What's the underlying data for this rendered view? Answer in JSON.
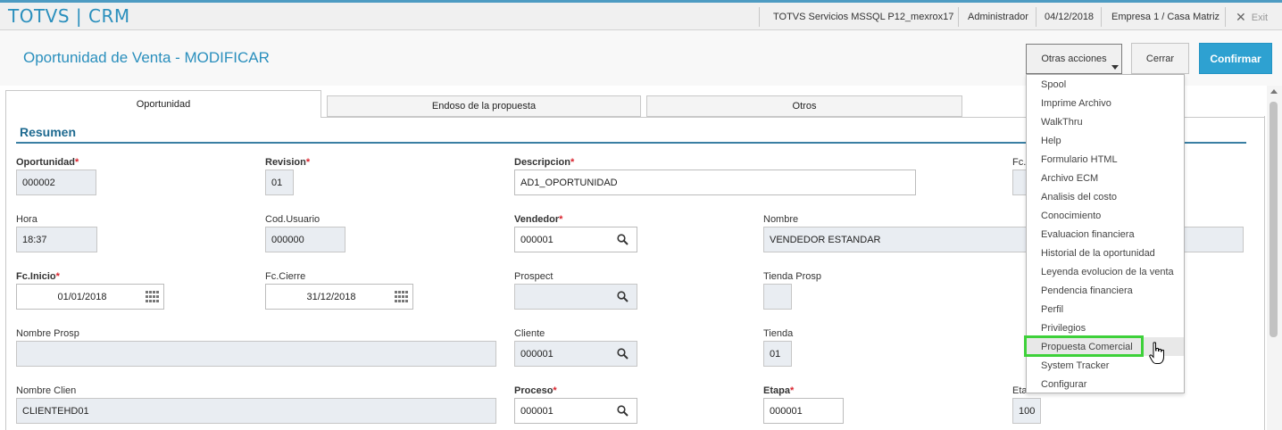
{
  "topbar": {
    "brand": "TOTVS | CRM",
    "server": "TOTVS Servicios MSSQL P12_mexrox17",
    "user": "Administrador",
    "date": "04/12/2018",
    "company": "Empresa 1 / Casa Matriz",
    "exit_label": "Exit"
  },
  "header": {
    "title": "Oportunidad de Venta - MODIFICAR",
    "otras_acciones": "Otras acciones",
    "cerrar": "Cerrar",
    "confirmar": "Confirmar"
  },
  "tabs": [
    {
      "label": "Oportunidad"
    },
    {
      "label": "Endoso de la propuesta"
    },
    {
      "label": "Otros"
    }
  ],
  "section": {
    "title": "Resumen"
  },
  "fields": {
    "oportunidad": {
      "label": "Oportunidad",
      "value": "000002"
    },
    "revision": {
      "label": "Revision",
      "value": "01"
    },
    "descripcion": {
      "label": "Descripcion",
      "value": "AD1_OPORTUNIDAD"
    },
    "fc_partial": {
      "label": "Fc."
    },
    "hora": {
      "label": "Hora",
      "value": "18:37"
    },
    "cod_usuario": {
      "label": "Cod.Usuario",
      "value": "000000"
    },
    "vendedor": {
      "label": "Vendedor",
      "value": "000001"
    },
    "nombre": {
      "label": "Nombre",
      "value": "VENDEDOR ESTANDAR"
    },
    "fc_inicio": {
      "label": "Fc.Inicio",
      "value": "01/01/2018"
    },
    "fc_cierre": {
      "label": "Fc.Cierre",
      "value": "31/12/2018"
    },
    "prospect": {
      "label": "Prospect",
      "value": ""
    },
    "tienda_prosp": {
      "label": "Tienda Prosp",
      "value": ""
    },
    "nombre_prosp": {
      "label": "Nombre Prosp",
      "value": ""
    },
    "cliente": {
      "label": "Cliente",
      "value": "000001"
    },
    "tienda": {
      "label": "Tienda",
      "value": "01"
    },
    "nombre_clien": {
      "label": "Nombre Clien",
      "value": "CLIENTEHD01"
    },
    "proceso": {
      "label": "Proceso",
      "value": "000001"
    },
    "etapa": {
      "label": "Etapa",
      "value": "000001"
    },
    "etapa_partial": {
      "label": "Eta",
      "value": "100"
    }
  },
  "menu": {
    "items": [
      "Spool",
      "Imprime Archivo",
      "WalkThru",
      "Help",
      "Formulario HTML",
      "Archivo ECM",
      "Analisis del costo",
      "Conocimiento",
      "Evaluacion financiera",
      "Historial de la oportunidad",
      "Leyenda evolucion de la venta",
      "Pendencia financiera",
      "Perfil",
      "Privilegios",
      "Propuesta Comercial",
      "System Tracker",
      "Configurar"
    ],
    "highlighted_index": 14,
    "highlight_color": "#3ed13a"
  },
  "colors": {
    "accent": "#2a8fbd",
    "confirm_button": "#2ea1d1",
    "required_star": "#d9232d"
  }
}
